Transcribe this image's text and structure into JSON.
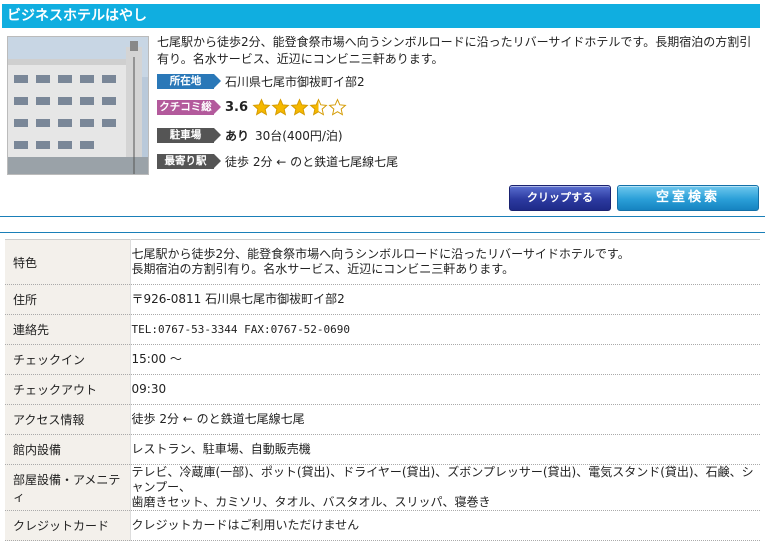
{
  "hotel": {
    "name": "ビジネスホテルはやし",
    "summary": "七尾駅から徒歩2分、能登食祭市場へ向うシンボルロードに沿ったリバーサイドホテルです。長期宿泊の方割引有り。名水サービス、近辺にコンビニ三軒あります。"
  },
  "info": {
    "address_label": "所在地",
    "address": "石川県七尾市御祓町イ部2",
    "review_label": "クチコミ総合",
    "review_score": "3.6",
    "review_stars": 3.5,
    "parking_label": "駐車場",
    "parking_avail": "あり",
    "parking_detail": "30台(400円/泊)",
    "station_label": "最寄り駅",
    "station": "徒歩 2分 ← のと鉄道七尾線七尾"
  },
  "buttons": {
    "clip": "クリップする",
    "vacancy": "空室検索"
  },
  "details": [
    {
      "key": "特色",
      "lines": [
        "七尾駅から徒歩2分、能登食祭市場へ向うシンボルロードに沿ったリバーサイドホテルです。",
        "長期宿泊の方割引有り。名水サービス、近辺にコンビニ三軒あります。"
      ]
    },
    {
      "key": "住所",
      "lines": [
        "〒926-0811 石川県七尾市御祓町イ部2"
      ]
    },
    {
      "key": "連絡先",
      "lines": [
        "TEL:0767-53-3344 FAX:0767-52-0690"
      ]
    },
    {
      "key": "チェックイン",
      "lines": [
        "15:00 〜"
      ]
    },
    {
      "key": "チェックアウト",
      "lines": [
        "09:30"
      ]
    },
    {
      "key": "アクセス情報",
      "lines": [
        "徒歩 2分 ← のと鉄道七尾線七尾"
      ]
    },
    {
      "key": "館内設備",
      "lines": [
        "レストラン、駐車場、自動販売機"
      ]
    },
    {
      "key": "部屋設備・アメニティ",
      "lines": [
        "テレビ、冷蔵庫(一部)、ポット(貸出)、ドライヤー(貸出)、ズボンプレッサー(貸出)、電気スタンド(貸出)、石鹸、シャンプー、",
        "歯磨きセット、カミソリ、タオル、バスタオル、スリッパ、寝巻き"
      ]
    },
    {
      "key": "クレジットカード",
      "lines": [
        "クレジットカードはご利用いただけません"
      ]
    }
  ],
  "colors": {
    "title_bar": "#10aee0",
    "tag_blue": "#2a78b8",
    "tag_pink": "#b35a9c",
    "tag_dark": "#555555",
    "star": "#f5b800"
  }
}
